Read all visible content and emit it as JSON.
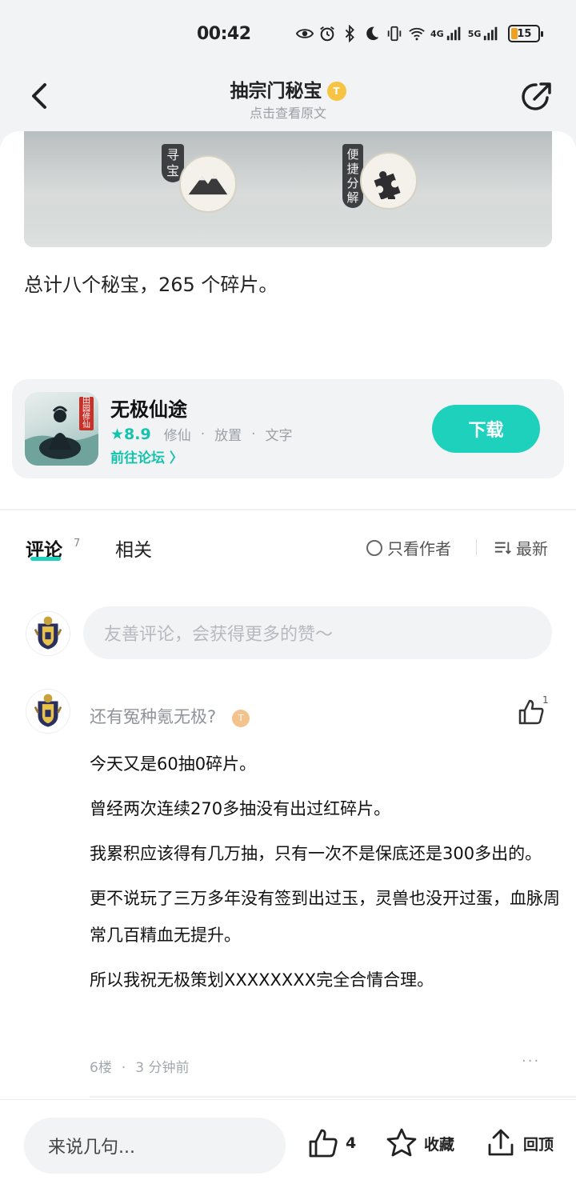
{
  "status": {
    "time": "00:42",
    "net1": "4G",
    "net2": "5G",
    "battery": "15"
  },
  "header": {
    "title": "抽宗门秘宝",
    "title_badge": "T",
    "subtitle": "点击查看原文"
  },
  "banner": {
    "tag_left": "寻宝",
    "tag_right": "便捷分解"
  },
  "post": {
    "summary": "总计八个秘宝，265 个碎片。"
  },
  "game": {
    "name": "无极仙途",
    "rating": "★8.9",
    "tags": [
      "修仙",
      "放置",
      "文字"
    ],
    "forum_link": "前往论坛 〉",
    "download": "下载",
    "icon_seal": "田园修仙"
  },
  "tabs": {
    "comments": "评论",
    "comments_count": "7",
    "related": "相关",
    "author_only": "只看作者",
    "sort": "最新"
  },
  "comment_input": {
    "placeholder": "友善评论，会获得更多的赞～"
  },
  "comment": {
    "username": "还有冤种氪无极?",
    "badge": "T",
    "like_count": "1",
    "paragraphs": [
      "今天又是60抽0碎片。",
      "曾经两次连续270多抽没有出过红碎片。",
      "我累积应该得有几万抽，只有一次不是保底还是300多出的。",
      "更不说玩了三万多年没有签到出过玉，灵兽也没开过蛋，血脉周常几百精血无提升。",
      "所以我祝无极策划XXXXXXXX完全合情合理。"
    ],
    "floor": "6楼",
    "time": "3 分钟前",
    "more": "···"
  },
  "bottom": {
    "input_placeholder": "来说几句...",
    "like_count": "4",
    "favorite": "收藏",
    "top": "回顶"
  },
  "colors": {
    "accent": "#1dd1bc",
    "background": "#f2f3f5"
  }
}
